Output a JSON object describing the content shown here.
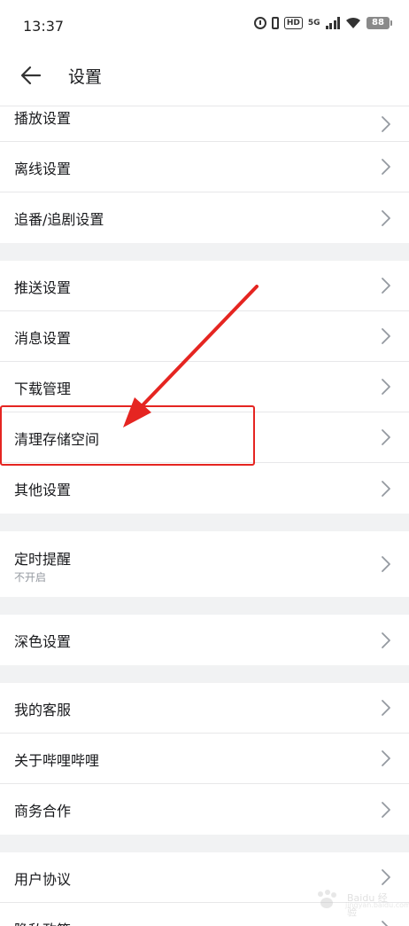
{
  "status_bar": {
    "time": "13:37",
    "network": "5G",
    "hd": "HD",
    "battery": "88"
  },
  "header": {
    "title": "设置"
  },
  "groups": [
    [
      {
        "label": "播放设置"
      },
      {
        "label": "离线设置"
      },
      {
        "label": "追番/追剧设置"
      }
    ],
    [
      {
        "label": "推送设置"
      },
      {
        "label": "消息设置"
      },
      {
        "label": "下载管理"
      },
      {
        "label": "清理存储空间"
      },
      {
        "label": "其他设置"
      }
    ],
    [
      {
        "label": "定时提醒",
        "sub": "不开启"
      }
    ],
    [
      {
        "label": "深色设置"
      }
    ],
    [
      {
        "label": "我的客服"
      },
      {
        "label": "关于哔哩哔哩"
      },
      {
        "label": "商务合作"
      }
    ],
    [
      {
        "label": "用户协议"
      },
      {
        "label": "隐私政策"
      }
    ]
  ],
  "annotation": {
    "color": "#e52521"
  },
  "watermark": {
    "text": "Baidu 经验",
    "url": "jingyan.baidu.com"
  },
  "colors": {
    "background": "#f1f2f3",
    "card": "#ffffff",
    "text": "#18191c",
    "subtext": "#9499a0",
    "chevron": "#9499a0"
  }
}
